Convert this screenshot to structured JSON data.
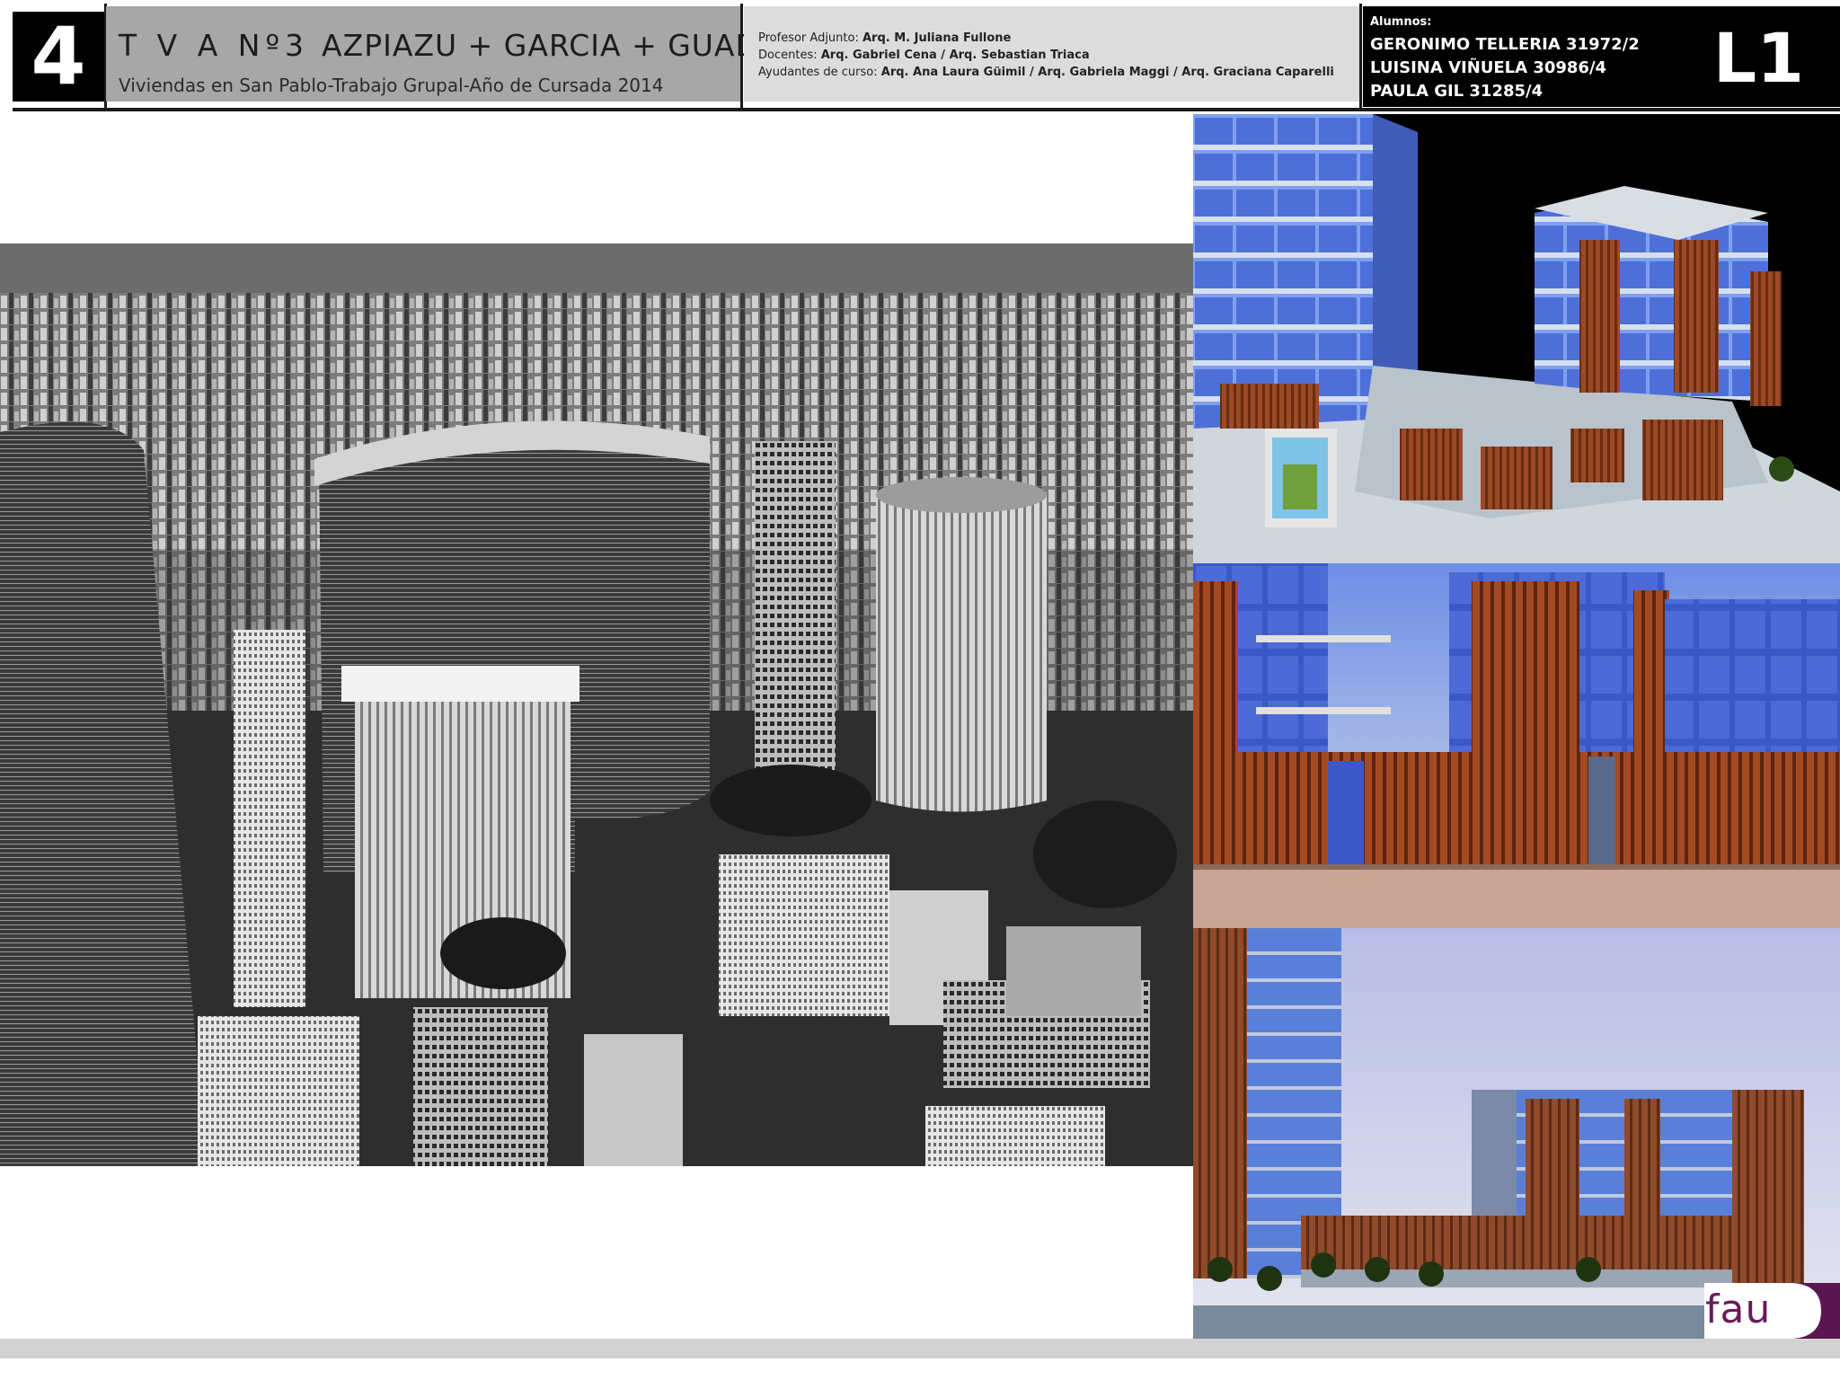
{
  "header": {
    "lamina_number": "4",
    "title_tva": "T V A Nº3",
    "title_names": "AZPIAZU + GARCIA + GUADAGNA",
    "subtitle": "Viviendas en San Pablo-Trabajo Grupal-Año de Cursada 2014",
    "staff": [
      {
        "label": "Profesor Adjunto: ",
        "value": "Arq. M. Juliana Fullone"
      },
      {
        "label": "Docentes: ",
        "value": "Arq. Gabriel Cena / Arq. Sebastian Triaca"
      },
      {
        "label": "Ayudantes de curso: ",
        "value": "Arq. Ana Laura Güimil / Arq. Gabriela Maggi / Arq. Graciana Caparelli"
      }
    ],
    "students_label": "Alumnos:",
    "students": [
      "GERONIMO TELLERIA 31972/2",
      "LUISINA VIÑUELA 30986/4",
      "PAULA GIL 31285/4"
    ],
    "lamina_code": "L1"
  },
  "footer": {
    "logo_text": "fau",
    "logo_color": "#6a1a5a"
  },
  "colors": {
    "title_box": "#a7a7a7",
    "staff_box": "#dcdcdc",
    "render_glass": "#5d7ee6",
    "render_wood": "#8b3a1e"
  }
}
